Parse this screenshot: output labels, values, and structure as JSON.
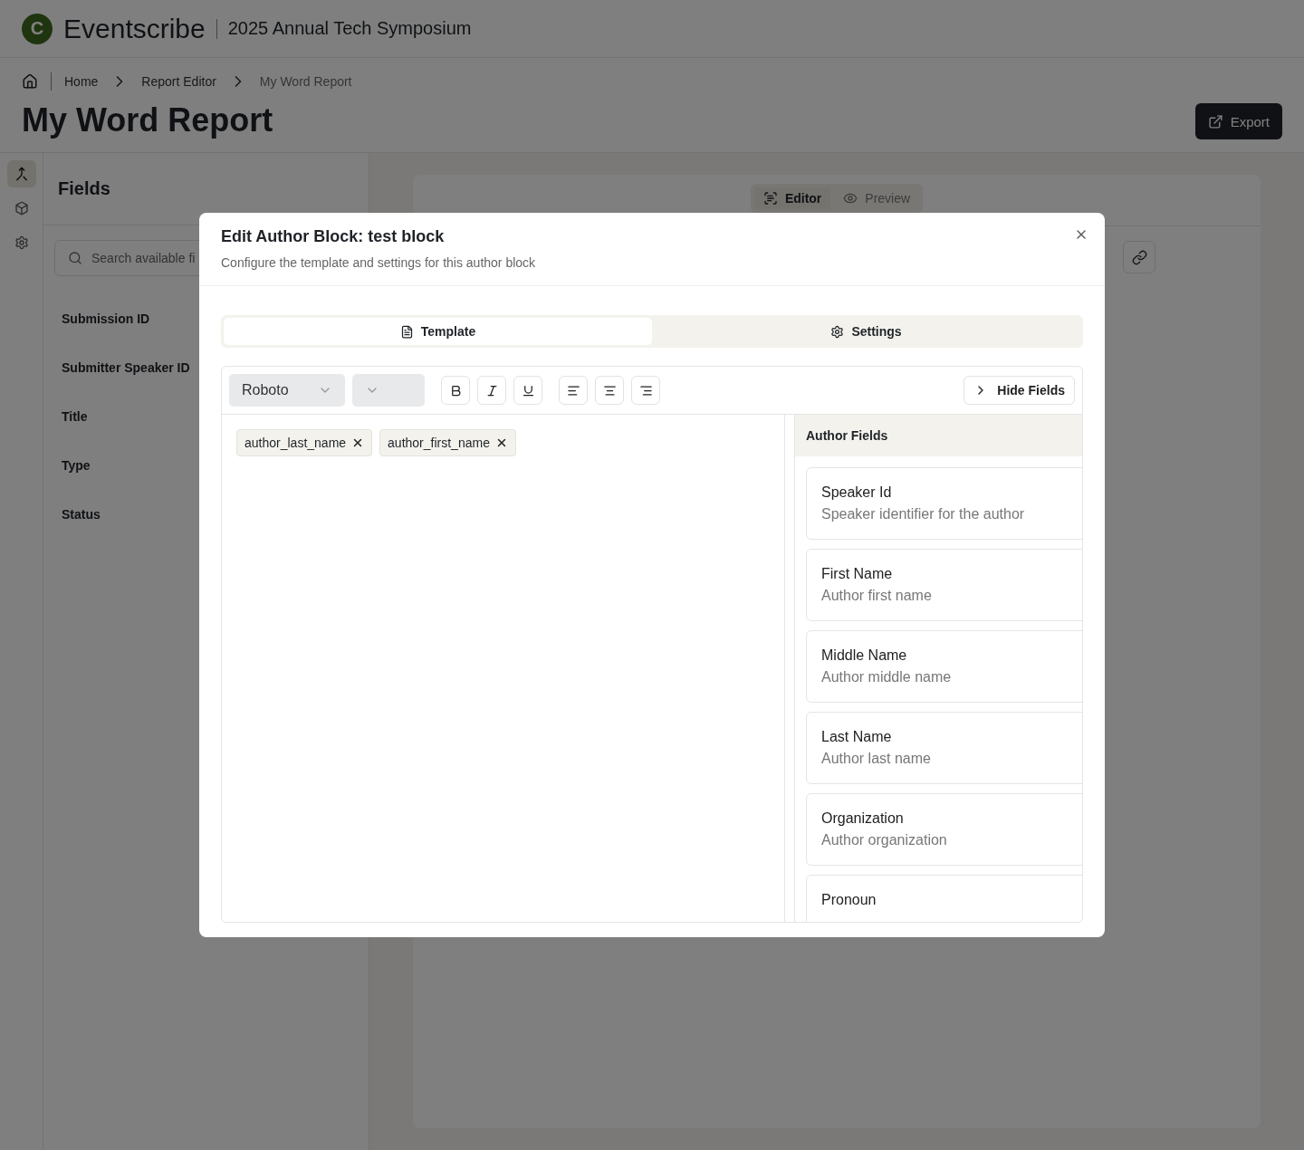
{
  "header": {
    "logo_mark": "C",
    "brand": "Eventscribe",
    "event": "2025 Annual Tech Symposium"
  },
  "breadcrumbs": [
    {
      "label": "Home",
      "selected": false
    },
    {
      "label": "Report Editor",
      "selected": false
    },
    {
      "label": "My Word Report",
      "selected": true
    }
  ],
  "page_title": "My Word Report",
  "export_button": "Export",
  "rail": [
    {
      "selected": true
    },
    {
      "selected": false
    },
    {
      "selected": false
    }
  ],
  "fields_panel": {
    "title": "Fields",
    "search": {
      "placeholder": "Search available fi"
    },
    "items": [
      "Submission ID",
      "Submitter Speaker ID",
      "Title",
      "Type",
      "Status"
    ]
  },
  "editor_card": {
    "tabs": [
      {
        "label": "Editor",
        "selected": true
      },
      {
        "label": "Preview",
        "selected": false
      }
    ]
  },
  "modal": {
    "title": "Edit Author Block: test block",
    "description": "Configure the template and settings for this author block",
    "tabs": [
      {
        "label": "Template",
        "selected": true
      },
      {
        "label": "Settings",
        "selected": false
      }
    ],
    "font": "Roboto",
    "hide_fields_button": "Hide Fields",
    "tokens": [
      "author_last_name",
      "author_first_name"
    ],
    "author_fields": {
      "title": "Author Fields",
      "items": [
        {
          "name": "Speaker Id",
          "description": "Speaker identifier for the author"
        },
        {
          "name": "First Name",
          "description": "Author first name"
        },
        {
          "name": "Middle Name",
          "description": "Author middle name"
        },
        {
          "name": "Last Name",
          "description": "Author last name"
        },
        {
          "name": "Organization",
          "description": "Author organization"
        },
        {
          "name": "Pronoun"
        }
      ]
    }
  }
}
